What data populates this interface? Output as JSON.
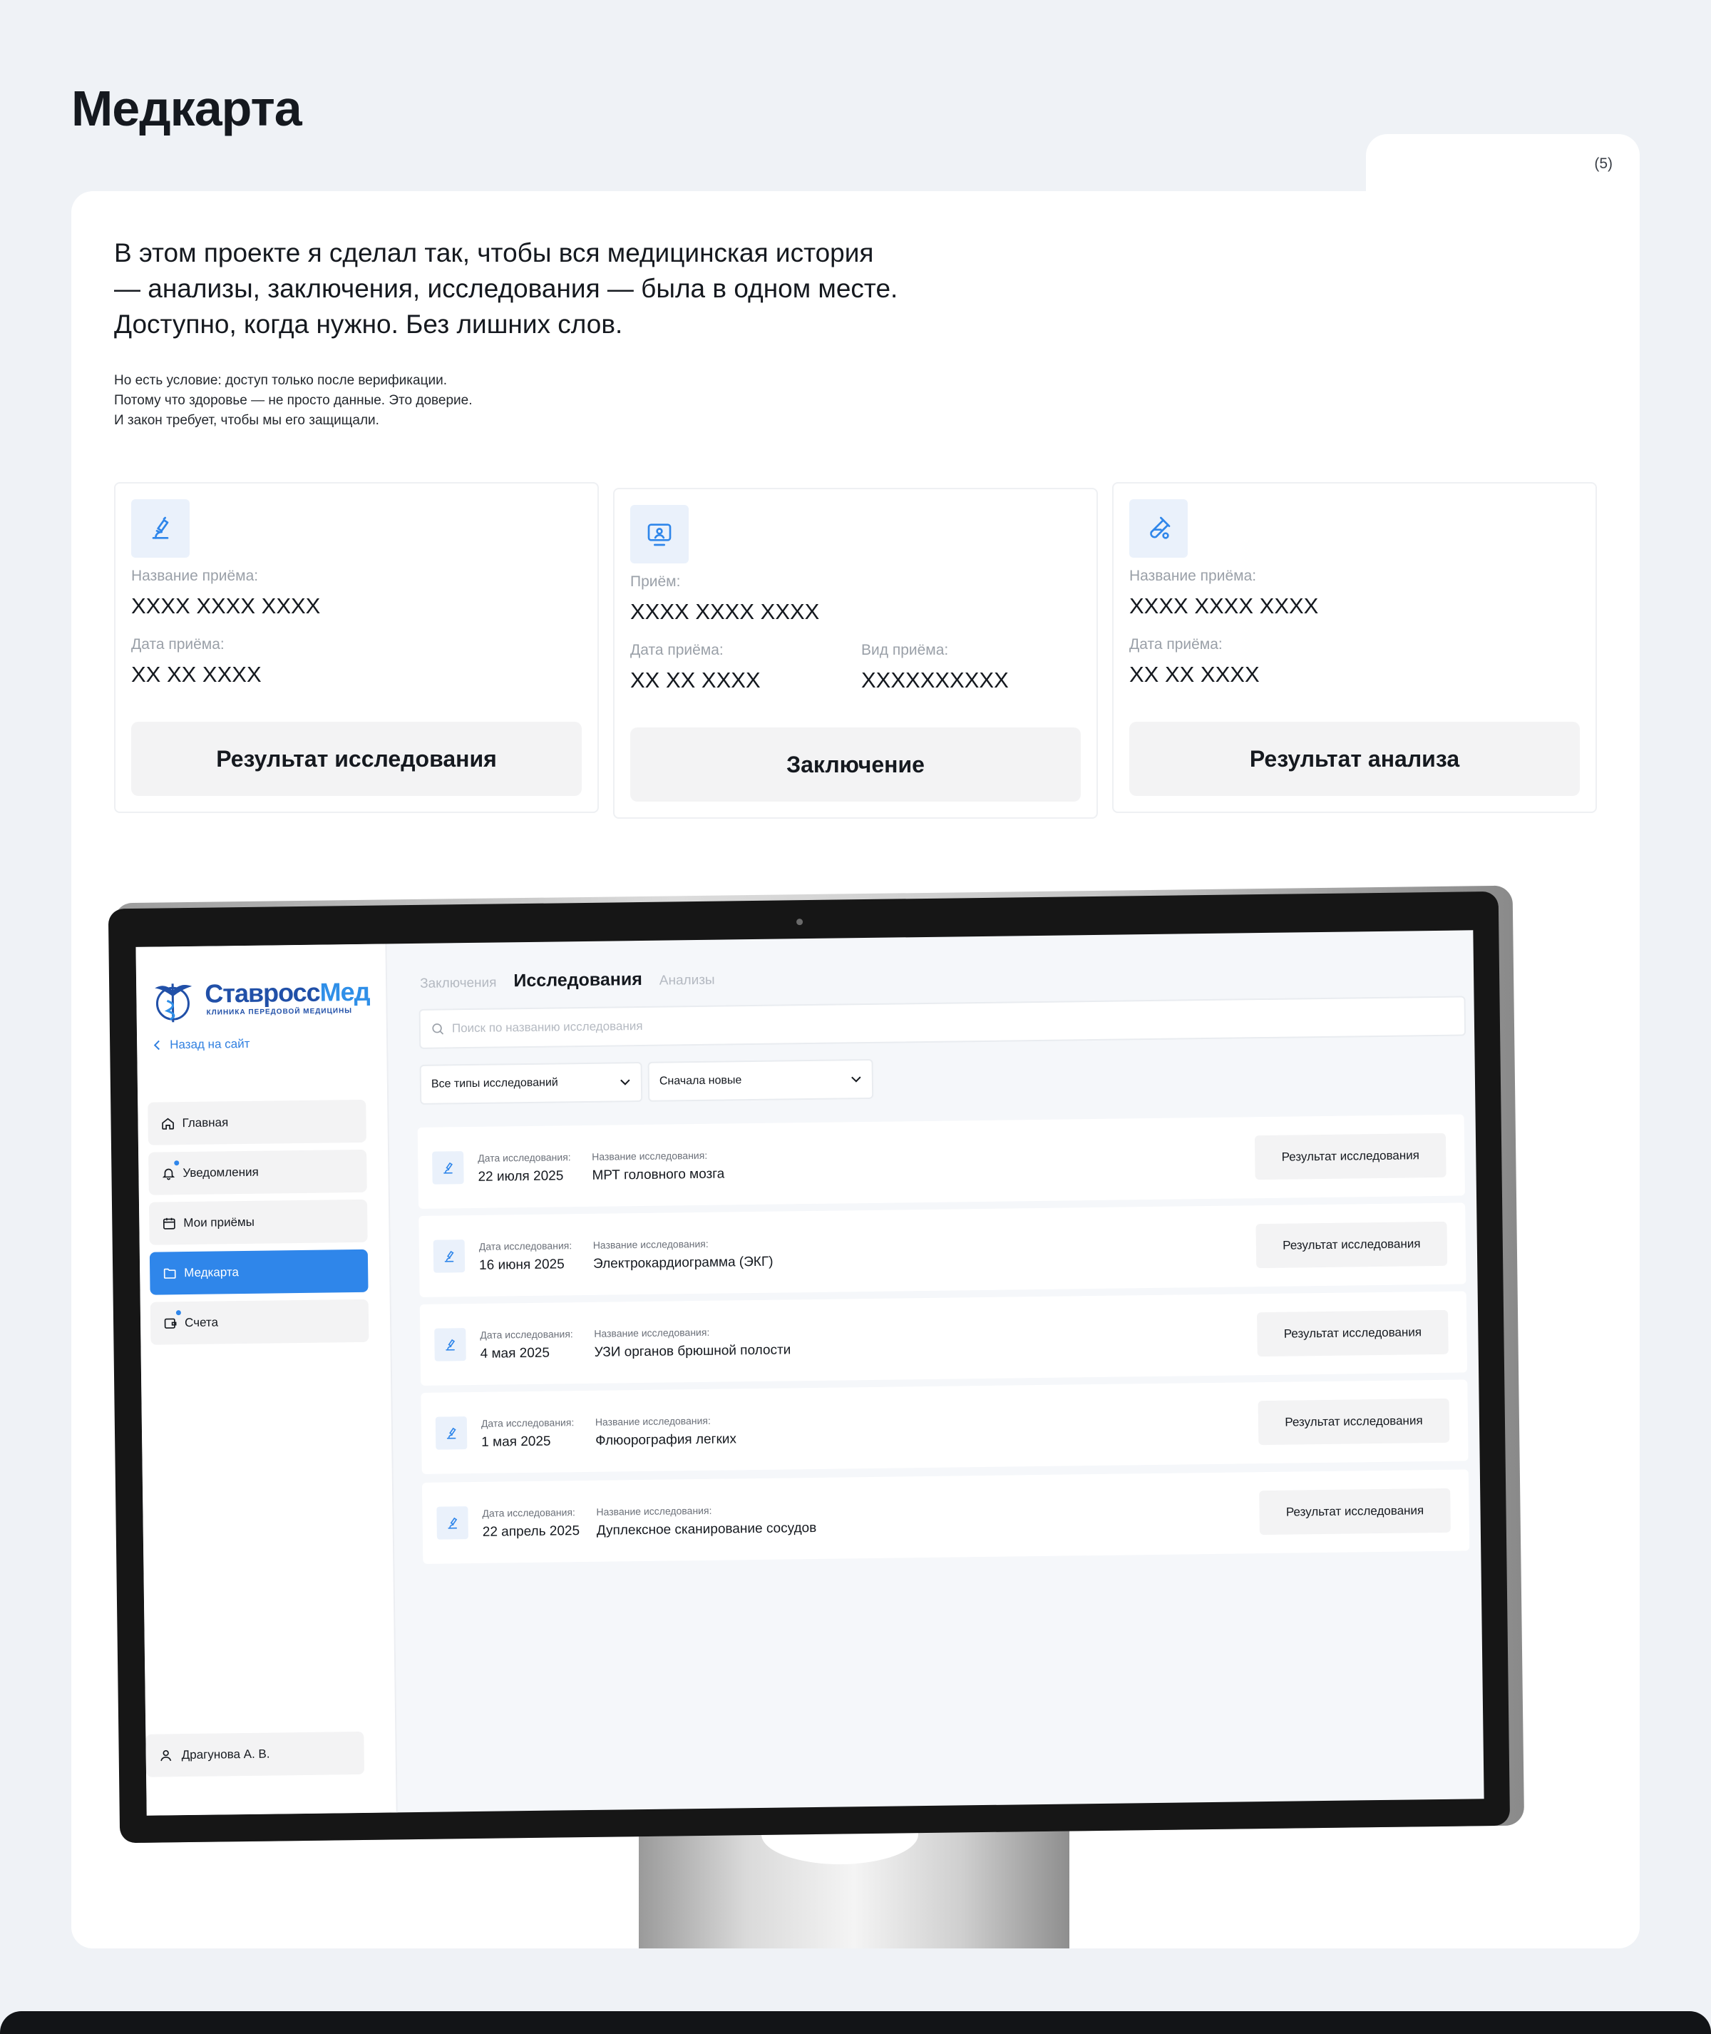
{
  "page": {
    "title": "Медкарта",
    "counter": "(5)"
  },
  "intro": {
    "line1": "В этом проекте я сделал так, чтобы вся медицинская история",
    "line2": "— анализы, заключения, исследования — была в одном месте.",
    "line3": "Доступно, когда нужно. Без лишних слов."
  },
  "note": {
    "line1": "Но есть условие: доступ только после верификации.",
    "line2": "Потому что здоровье — не просто данные. Это доверие.",
    "line3": "И закон требует, чтобы мы его защищали."
  },
  "cards": [
    {
      "icon": "microscope-icon",
      "label1": "Название приёма:",
      "value1": "XXXX XXXX XXXX",
      "label2": "Дата приёма:",
      "value2": "XX XX XXXX",
      "button": "Результат исследования"
    },
    {
      "icon": "doctor-screen-icon",
      "label1": "Приём:",
      "value1": "XXXX XXXX XXXX",
      "label2": "Дата приёма:",
      "value2": "XX XX XXXX",
      "label3": "Вид приёма:",
      "value3": "XXXXXXXXXX",
      "button": "Заключение"
    },
    {
      "icon": "test-tube-icon",
      "label1": "Название приёма:",
      "value1": "XXXX XXXX XXXX",
      "label2": "Дата приёма:",
      "value2": "XX XX XXXX",
      "button": "Результат анализа"
    }
  ],
  "app": {
    "logo": {
      "part1": "Ставросс",
      "part2": "Мед",
      "subtitle": "КЛИНИКА ПЕРЕДОВОЙ МЕДИЦИНЫ"
    },
    "back_link": "Назад на сайт",
    "nav": [
      {
        "label": "Главная",
        "icon": "home-icon"
      },
      {
        "label": "Уведомления",
        "icon": "bell-icon"
      },
      {
        "label": "Мои приёмы",
        "icon": "calendar-icon"
      },
      {
        "label": "Медкарта",
        "icon": "folder-icon",
        "active": true
      },
      {
        "label": "Счета",
        "icon": "wallet-icon"
      }
    ],
    "user": "Драгунова А. В.",
    "tabs": [
      "Заключения",
      "Исследования",
      "Анализы"
    ],
    "active_tab": "Исследования",
    "search_placeholder": "Поиск по названию исследования",
    "filters": {
      "type": "Все типы исследований",
      "sort": "Сначала новые"
    },
    "row_labels": {
      "date": "Дата исследования:",
      "name": "Название исследования:",
      "button": "Результат исследования"
    },
    "rows": [
      {
        "date": "22 июля 2025",
        "name": "МРТ головного мозга"
      },
      {
        "date": "16 июня 2025",
        "name": "Электрокардиограмма (ЭКГ)"
      },
      {
        "date": "4 мая 2025",
        "name": "УЗИ органов брюшной полости"
      },
      {
        "date": "1 мая 2025",
        "name": "Флюорография легких"
      },
      {
        "date": "22 апрель 2025",
        "name": "Дуплексное сканирование сосудов"
      }
    ],
    "colors": {
      "accent": "#2f86ea",
      "brand": "#2150a8",
      "icon_bg": "#eaf1fb"
    }
  }
}
